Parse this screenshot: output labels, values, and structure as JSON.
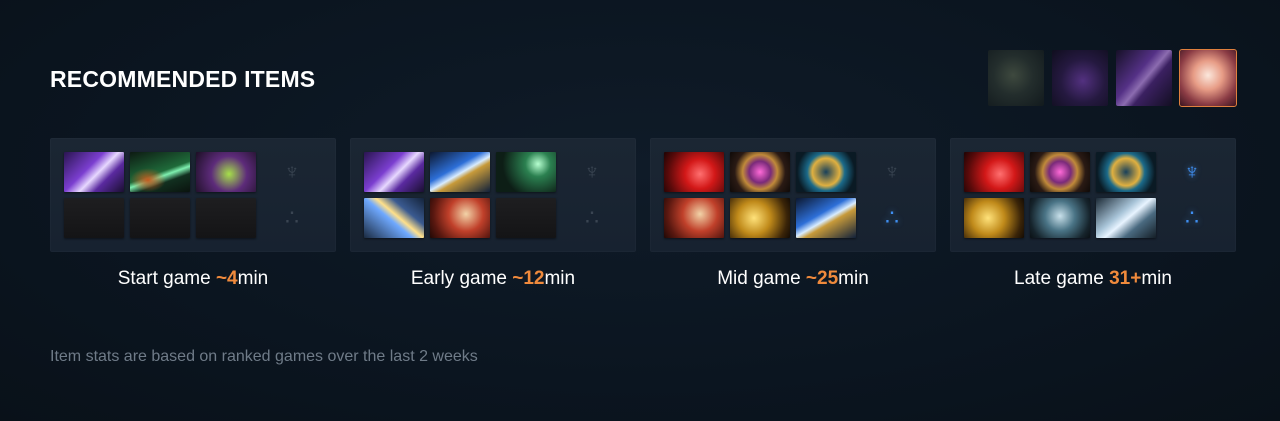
{
  "section": {
    "title": "RECOMMENDED ITEMS",
    "footnote": "Item stats are based on ranked games over the last 2 weeks"
  },
  "ability_icons": [
    {
      "name": "ability-1-icon",
      "selected": false
    },
    {
      "name": "ability-2-icon",
      "selected": false
    },
    {
      "name": "ability-3-icon",
      "selected": false
    },
    {
      "name": "ability-4-icon",
      "selected": true,
      "accent": "#e0803e"
    }
  ],
  "stages": [
    {
      "label": "Start game ",
      "time": "~4",
      "unit": "min",
      "items": [
        "crystal-item-icon",
        "branch-item-icon",
        "sack-item-icon",
        "empty",
        "empty",
        "empty"
      ],
      "neutral_token": "dim",
      "neutral_item": "dim"
    },
    {
      "label": "Early game ",
      "time": "~12",
      "unit": "min",
      "items": [
        "crystal-item-icon",
        "blade-item-icon",
        "wand-item-icon",
        "spear-item-icon",
        "cloak-item-icon",
        "empty"
      ],
      "neutral_token": "dim",
      "neutral_item": "dim"
    },
    {
      "label": "Mid game ",
      "time": "~25",
      "unit": "min",
      "items": [
        "red-item-icon",
        "orb-item-icon",
        "ring-item-icon",
        "cloak-item-icon",
        "gold-item-icon",
        "blade-item-icon"
      ],
      "neutral_token": "dim",
      "neutral_item": "lit"
    },
    {
      "label": "Late game ",
      "time": "31+",
      "unit": "min",
      "items": [
        "red-item-icon",
        "orb-item-icon",
        "ring-item-icon",
        "gold-item-icon",
        "helm-item-icon",
        "hammer-item-icon"
      ],
      "neutral_token": "lit",
      "neutral_item": "lit"
    }
  ],
  "colors": {
    "accent": "#f08a3c",
    "neutral_lit": "#3f8ef0",
    "neutral_dim": "#3a4552"
  }
}
